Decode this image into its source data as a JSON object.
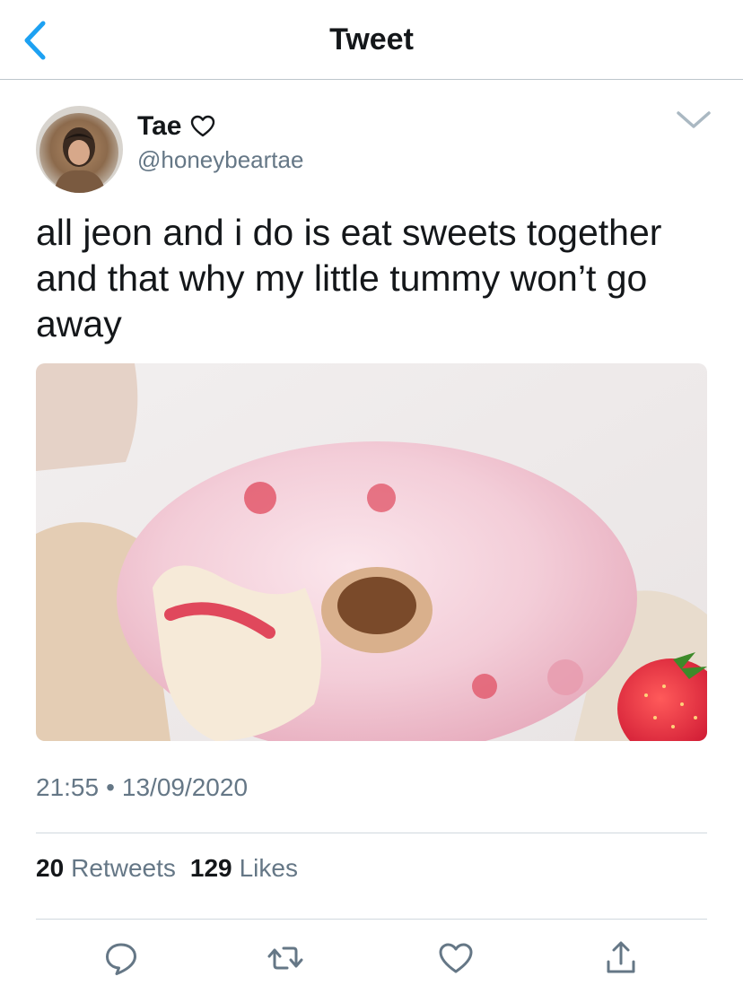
{
  "nav": {
    "title": "Tweet",
    "back_icon": "chevron-left-icon"
  },
  "tweet": {
    "author_name": "Tae",
    "name_emoji_icon": "white-heart-icon",
    "handle": "@honeybeartae",
    "text": "all jeon and i do is eat sweets together and that why my little tummy won’t go away",
    "time": "21:55",
    "separator": "•",
    "date": "13/09/2020",
    "retweet_count": "20",
    "retweet_label": "Retweets",
    "like_count": "129",
    "like_label": "Likes"
  },
  "actions": [
    "reply-icon",
    "retweet-icon",
    "like-icon",
    "share-icon"
  ],
  "colors": {
    "accent": "#1da1f2",
    "icon_gray": "#657786",
    "text": "#14171a",
    "border": "#d0d8de"
  }
}
